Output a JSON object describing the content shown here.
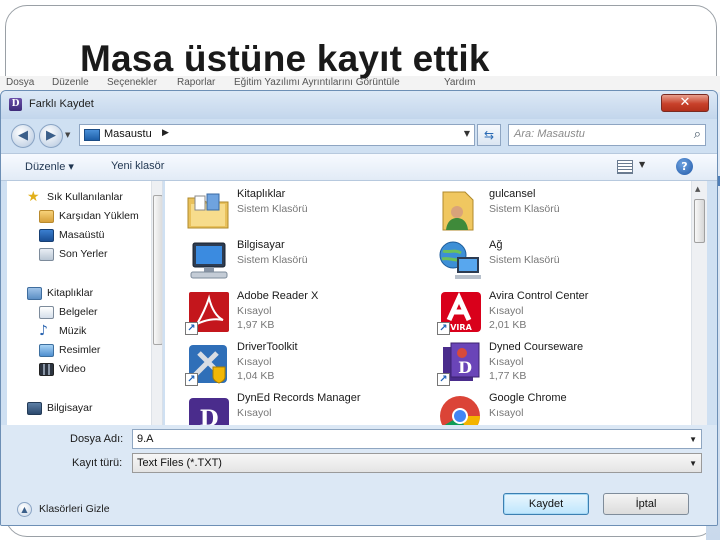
{
  "slide": {
    "title": "Masa üstüne kayıt ettik"
  },
  "background_menu": [
    "Dosya",
    "Düzenle",
    "Seçenekler",
    "Raporlar",
    "Eğitim Yazılımı Ayrıntılarını Görüntüle",
    "Yardım"
  ],
  "dialog": {
    "title": "Farklı Kaydet",
    "close_glyph": "✕"
  },
  "nav": {
    "back_glyph": "◀",
    "forward_glyph": "▶",
    "address": "Masaustu",
    "search_placeholder": "Ara: Masaustu"
  },
  "toolbar": {
    "organize": "Düzenle ▾",
    "new_folder": "Yeni klasör",
    "help_glyph": "?"
  },
  "left_pane": {
    "items": [
      {
        "label": "Sık Kullanılanlar",
        "icon": "star-icon",
        "indent": false
      },
      {
        "label": "Karşıdan Yüklem",
        "icon": "download-folder-icon",
        "indent": true
      },
      {
        "label": "Masaüstü",
        "icon": "desktop-icon",
        "indent": true
      },
      {
        "label": "Son Yerler",
        "icon": "recent-places-icon",
        "indent": true
      },
      {
        "label": "Kitaplıklar",
        "icon": "libraries-icon",
        "indent": false
      },
      {
        "label": "Belgeler",
        "icon": "documents-icon",
        "indent": true
      },
      {
        "label": "Müzik",
        "icon": "music-icon",
        "indent": true
      },
      {
        "label": "Resimler",
        "icon": "pictures-icon",
        "indent": true
      },
      {
        "label": "Video",
        "icon": "video-icon",
        "indent": true
      },
      {
        "label": "Bilgisayar",
        "icon": "computer-icon",
        "indent": false
      }
    ]
  },
  "files": [
    {
      "name": "Kitaplıklar",
      "type": "Sistem Klasörü",
      "size": "",
      "icon": "libraries-folder-icon",
      "shortcut": false
    },
    {
      "name": "gulcansel",
      "type": "Sistem Klasörü",
      "size": "",
      "icon": "user-folder-icon",
      "shortcut": false
    },
    {
      "name": "Bilgisayar",
      "type": "Sistem Klasörü",
      "size": "",
      "icon": "computer-icon",
      "shortcut": false
    },
    {
      "name": "Ağ",
      "type": "Sistem Klasörü",
      "size": "",
      "icon": "network-icon",
      "shortcut": false
    },
    {
      "name": "Adobe Reader X",
      "type": "Kısayol",
      "size": "1,97 KB",
      "icon": "adobe-reader-icon",
      "shortcut": true
    },
    {
      "name": "Avira Control Center",
      "type": "Kısayol",
      "size": "2,01 KB",
      "icon": "avira-icon",
      "shortcut": true
    },
    {
      "name": "DriverToolkit",
      "type": "Kısayol",
      "size": "1,04 KB",
      "icon": "driver-toolkit-icon",
      "shortcut": true
    },
    {
      "name": "Dyned Courseware",
      "type": "Kısayol",
      "size": "1,77 KB",
      "icon": "dyned-courseware-icon",
      "shortcut": true
    },
    {
      "name": "DynEd Records Manager",
      "type": "Kısayol",
      "size": "",
      "icon": "dyned-records-icon",
      "shortcut": false
    },
    {
      "name": "Google Chrome",
      "type": "Kısayol",
      "size": "",
      "icon": "chrome-icon",
      "shortcut": false
    }
  ],
  "form": {
    "filename_label": "Dosya Adı:",
    "filename_value": "9.A",
    "savetype_label": "Kayıt türü:",
    "savetype_value": "Text Files (*.TXT)",
    "hide_folders": "Klasörleri Gizle",
    "save_button": "Kaydet",
    "cancel_button": "İptal"
  }
}
